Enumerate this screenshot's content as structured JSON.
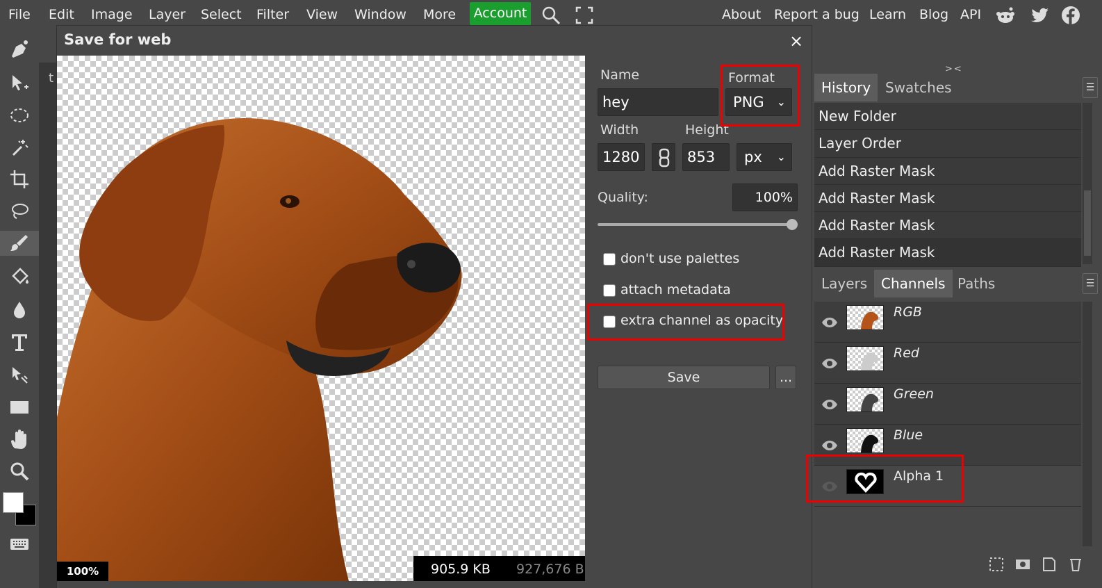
{
  "menu": {
    "file": "File",
    "edit": "Edit",
    "image": "Image",
    "layer": "Layer",
    "select": "Select",
    "filter": "Filter",
    "view": "View",
    "window": "Window",
    "more": "More",
    "account": "Account",
    "about": "About",
    "report_bug": "Report a bug",
    "learn": "Learn",
    "blog": "Blog",
    "api": "API"
  },
  "doc_tab": {
    "label": "t"
  },
  "dialog": {
    "title": "Save for web",
    "close": "×",
    "zoom": "100%",
    "size_kb": "905.9 KB",
    "size_bytes": "927,676 B",
    "name_label": "Name",
    "name_value": "hey",
    "format_label": "Format",
    "format_value": "PNG",
    "width_label": "Width",
    "width_value": "1280",
    "height_label": "Height",
    "height_value": "853",
    "unit_value": "px",
    "quality_label": "Quality:",
    "quality_value": "100%",
    "quality_fraction": 1.0,
    "opt_palettes": "don't use palettes",
    "opt_metadata": "attach metadata",
    "opt_opacity": "extra channel as opacity",
    "save": "Save",
    "more": "..."
  },
  "panels": {
    "collapse": "><",
    "history_tab": "History",
    "swatches_tab": "Swatches",
    "history": [
      "New Folder",
      "Layer Order",
      "Add Raster Mask",
      "Add Raster Mask",
      "Add Raster Mask",
      "Add Raster Mask"
    ],
    "layers_tab": "Layers",
    "channels_tab": "Channels",
    "paths_tab": "Paths",
    "channels": [
      "RGB",
      "Red",
      "Green",
      "Blue",
      "Alpha 1"
    ]
  },
  "colors": {
    "accent_green": "#1a9f2e",
    "highlight_red": "#e00000",
    "panel_bg": "#474747"
  }
}
